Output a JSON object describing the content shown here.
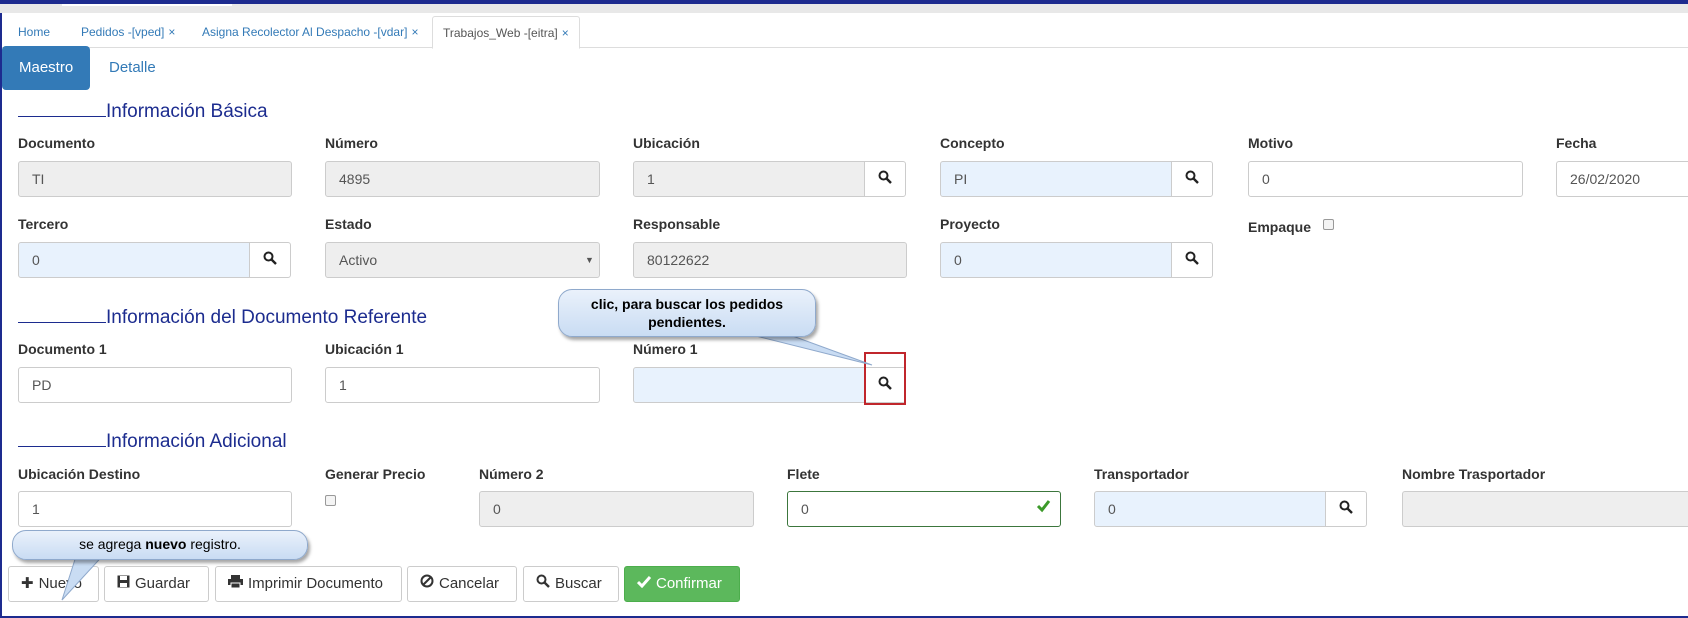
{
  "tabs": [
    {
      "label": "Home",
      "closable": false
    },
    {
      "label": "Pedidos -[vped]",
      "closable": true
    },
    {
      "label": "Asigna Recolector Al Despacho -[vdar]",
      "closable": true
    },
    {
      "label": "Trabajos_Web -[eitra]",
      "closable": true,
      "active": true
    }
  ],
  "close_symbol": "×",
  "subtabs": {
    "maestro": "Maestro",
    "detalle": "Detalle"
  },
  "sections": {
    "basica": "Información Básica",
    "referente": "Información del Documento Referente",
    "adicional": "Información Adicional"
  },
  "fields": {
    "documento": {
      "label": "Documento",
      "value": "TI"
    },
    "numero": {
      "label": "Número",
      "value": "4895"
    },
    "ubicacion": {
      "label": "Ubicación",
      "value": "1"
    },
    "concepto": {
      "label": "Concepto",
      "value": "PI"
    },
    "motivo": {
      "label": "Motivo",
      "value": "0"
    },
    "fecha": {
      "label": "Fecha",
      "value": "26/02/2020"
    },
    "tercero": {
      "label": "Tercero",
      "value": "0"
    },
    "estado": {
      "label": "Estado",
      "value": "Activo"
    },
    "responsable": {
      "label": "Responsable",
      "value": "80122622"
    },
    "proyecto": {
      "label": "Proyecto",
      "value": "0"
    },
    "empaque": {
      "label": "Empaque",
      "checked": false
    },
    "documento1": {
      "label": "Documento 1",
      "value": "PD"
    },
    "ubicacion1": {
      "label": "Ubicación 1",
      "value": "1"
    },
    "numero1": {
      "label": "Número 1",
      "value": ""
    },
    "ubicacion_destino": {
      "label": "Ubicación Destino",
      "value": "1"
    },
    "generar_precio": {
      "label": "Generar Precio",
      "checked": false
    },
    "numero2": {
      "label": "Número 2",
      "value": "0"
    },
    "flete": {
      "label": "Flete",
      "value": "0"
    },
    "transportador": {
      "label": "Transportador",
      "value": "0"
    },
    "nombre_transportador": {
      "label": "Nombre Trasportador",
      "value": ""
    }
  },
  "buttons": {
    "nuevo": "Nuevo",
    "guardar": "Guardar",
    "imprimir": "Imprimir Documento",
    "cancelar": "Cancelar",
    "buscar": "Buscar",
    "confirmar": "Confirmar"
  },
  "callouts": {
    "buscar_pedidos": "clic, para buscar los pedidos pendientes.",
    "nuevo_pre": "se agrega ",
    "nuevo_bold": "nuevo",
    "nuevo_post": " registro."
  },
  "icons": {
    "search": "search-icon",
    "plus": "plus-icon",
    "save": "floppy-disk-icon",
    "print": "print-icon",
    "cancel": "ban-icon",
    "confirm": "check-icon",
    "valid": "check-valid-icon"
  },
  "colors": {
    "primary": "#337ab7",
    "success": "#5cb85c",
    "section": "#1c2c8f",
    "highlight": "#c0262c",
    "frame": "#1d2b8f"
  }
}
